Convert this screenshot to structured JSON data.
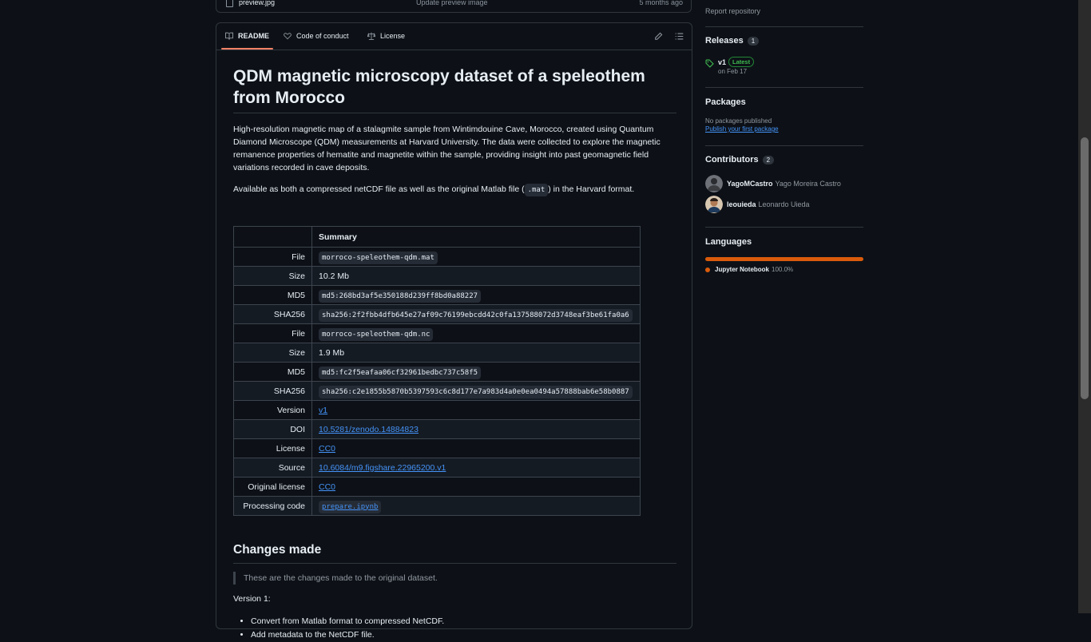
{
  "file_row": {
    "name": "preview.jpg",
    "message": "Update preview image",
    "date": "5 months ago"
  },
  "readme_tabs": {
    "readme": "README",
    "code_of_conduct": "Code of conduct",
    "license": "License"
  },
  "readme": {
    "title": "QDM magnetic microscopy dataset of a speleothem from Morocco",
    "description": "High-resolution magnetic map of a stalagmite sample from Wintimdouine Cave, Morocco, created using Quantum Diamond Microscope (QDM) measurements at Harvard University. The data were collected to explore the magnetic remanence properties of hematite and magnetite within the sample, providing insight into past geomagnetic field variations recorded in cave deposits.",
    "available_pre": "Available as both a compressed netCDF file as well as the original Matlab file (",
    "available_code": ".mat",
    "available_post": ") in the Harvard format.",
    "table_header": "Summary",
    "table": [
      {
        "key": "File",
        "value": "morroco-speleothem-qdm.mat",
        "kind": "code"
      },
      {
        "key": "Size",
        "value": "10.2 Mb",
        "kind": "text"
      },
      {
        "key": "MD5",
        "value": "md5:268bd3af5e350188d239ff8bd0a88227",
        "kind": "code"
      },
      {
        "key": "SHA256",
        "value": "sha256:2f2fbb4dfb645e27af09c76199ebcdd42c0fa137588072d3748eaf3be61fa0a6",
        "kind": "code"
      },
      {
        "key": "File",
        "value": "morroco-speleothem-qdm.nc",
        "kind": "code"
      },
      {
        "key": "Size",
        "value": "1.9 Mb",
        "kind": "text"
      },
      {
        "key": "MD5",
        "value": "md5:fc2f5eafaa06cf32961bedbc737c58f5",
        "kind": "code"
      },
      {
        "key": "SHA256",
        "value": "sha256:c2e1855b5870b5397593c6c8d177e7a983d4a0e0ea0494a57888bab6e58b0887",
        "kind": "code"
      },
      {
        "key": "Version",
        "value": "v1",
        "kind": "link"
      },
      {
        "key": "DOI",
        "value": "10.5281/zenodo.14884823",
        "kind": "link"
      },
      {
        "key": "License",
        "value": "CC0",
        "kind": "link"
      },
      {
        "key": "Source",
        "value": "10.6084/m9.figshare.22965200.v1",
        "kind": "link"
      },
      {
        "key": "Original license",
        "value": "CC0",
        "kind": "link"
      },
      {
        "key": "Processing code",
        "value": "prepare.ipynb",
        "kind": "codelink"
      }
    ],
    "changes_heading": "Changes made",
    "changes_quote": "These are the changes made to the original dataset.",
    "version_label": "Version 1:",
    "changes": [
      "Convert from Matlab format to compressed NetCDF.",
      "Add metadata to the NetCDF file."
    ]
  },
  "sidebar": {
    "report": "Report repository",
    "releases": {
      "title": "Releases",
      "count": "1",
      "tag": "v1",
      "badge": "Latest",
      "date": "on Feb 17"
    },
    "packages": {
      "title": "Packages",
      "none": "No packages published",
      "link": "Publish your first package"
    },
    "contributors": {
      "title": "Contributors",
      "count": "2",
      "people": [
        {
          "login": "YagoMCastro",
          "name": "Yago Moreira Castro"
        },
        {
          "login": "leouieda",
          "name": "Leonardo Uieda"
        }
      ]
    },
    "languages": {
      "title": "Languages",
      "name": "Jupyter Notebook",
      "percent": "100.0%",
      "share": 1.0,
      "color": "#DA5B0B"
    }
  },
  "colors": {
    "accent": "#f78166",
    "link": "#4493f8",
    "background": "#0d1117",
    "latest_badge": "#3fb950"
  }
}
